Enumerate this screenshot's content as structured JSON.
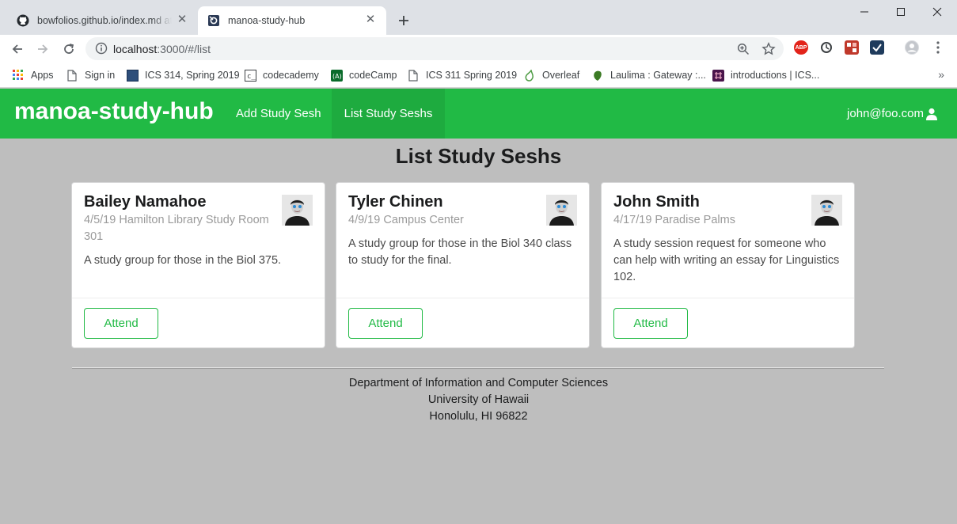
{
  "browser": {
    "tabs": [
      {
        "title": "bowfolios.github.io/index.md at m",
        "icon": "github-icon"
      },
      {
        "title": "manoa-study-hub",
        "icon": "meteor-icon"
      }
    ],
    "address": {
      "host": "localhost",
      "path": ":3000/#/list"
    },
    "bookmarks": [
      {
        "label": "Apps",
        "icon": "apps-grid-icon"
      },
      {
        "label": "Sign in",
        "icon": "page-icon"
      },
      {
        "label": "ICS 314, Spring 2019",
        "icon": "blue-square-icon"
      },
      {
        "label": "codecademy",
        "icon": "codecademy-icon"
      },
      {
        "label": "codeCamp",
        "icon": "freecodecamp-icon"
      },
      {
        "label": "ICS 311 Spring 2019",
        "icon": "page-icon"
      },
      {
        "label": "Overleaf",
        "icon": "overleaf-icon"
      },
      {
        "label": "Laulima : Gateway :...",
        "icon": "laulima-icon"
      },
      {
        "label": "introductions | ICS...",
        "icon": "slack-icon"
      }
    ],
    "extensions": [
      {
        "label": "ABP",
        "color": "#e2231a"
      }
    ]
  },
  "app": {
    "brand": "manoa-study-hub",
    "nav": {
      "add": "Add Study Sesh",
      "list": "List Study Seshs"
    },
    "user": "john@foo.com",
    "accent": "#21ba45"
  },
  "page": {
    "title": "List Study Seshs"
  },
  "cards": [
    {
      "name": "Bailey Namahoe",
      "meta": "4/5/19 Hamilton Library Study Room 301",
      "description": "A study group for those in the Biol 375.",
      "action": "Attend"
    },
    {
      "name": "Tyler Chinen",
      "meta": "4/9/19 Campus Center",
      "description": "A study group for those in the Biol 340 class to study for the final.",
      "action": "Attend"
    },
    {
      "name": "John Smith",
      "meta": "4/17/19 Paradise Palms",
      "description": "A study session request for someone who can help with writing an essay for Linguistics 102.",
      "action": "Attend"
    }
  ],
  "footer": {
    "line1": "Department of Information and Computer Sciences",
    "line2": "University of Hawaii",
    "line3": "Honolulu, HI 96822"
  }
}
